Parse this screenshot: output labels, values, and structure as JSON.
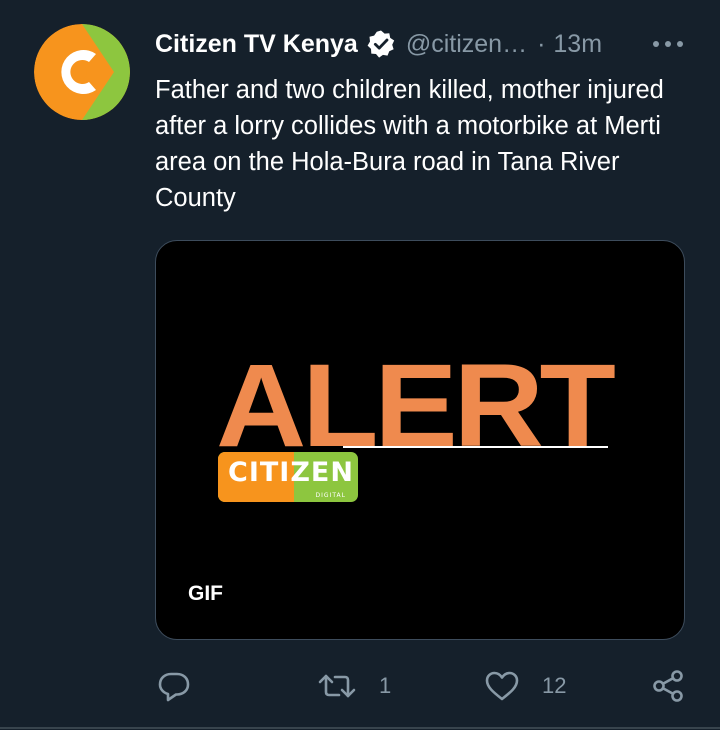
{
  "tweet": {
    "display_name": "Citizen TV Kenya",
    "handle": "@citizen…",
    "separator": "·",
    "timestamp": "13m",
    "text": "Father and two children killed, mother injured after a lorry collides with a motorbike at Merti area on the Hola-Bura road in Tana River County"
  },
  "media": {
    "headline": "ALERT",
    "brand": "CITIZEN",
    "brand_sub": "DIGITAL",
    "badge": "GIF"
  },
  "actions": {
    "reply_count": "",
    "retweet_count": "1",
    "like_count": "12"
  },
  "icons": {
    "avatar": "citizen-logo-icon",
    "verified": "verified-badge-icon",
    "more": "more-icon",
    "reply": "reply-icon",
    "retweet": "retweet-icon",
    "like": "heart-icon",
    "share": "share-icon"
  },
  "colors": {
    "background": "#15202b",
    "muted": "#8899a6",
    "alert_orange": "#ef8a4e",
    "citizen_orange": "#f7941d",
    "citizen_green": "#8dc63f"
  }
}
